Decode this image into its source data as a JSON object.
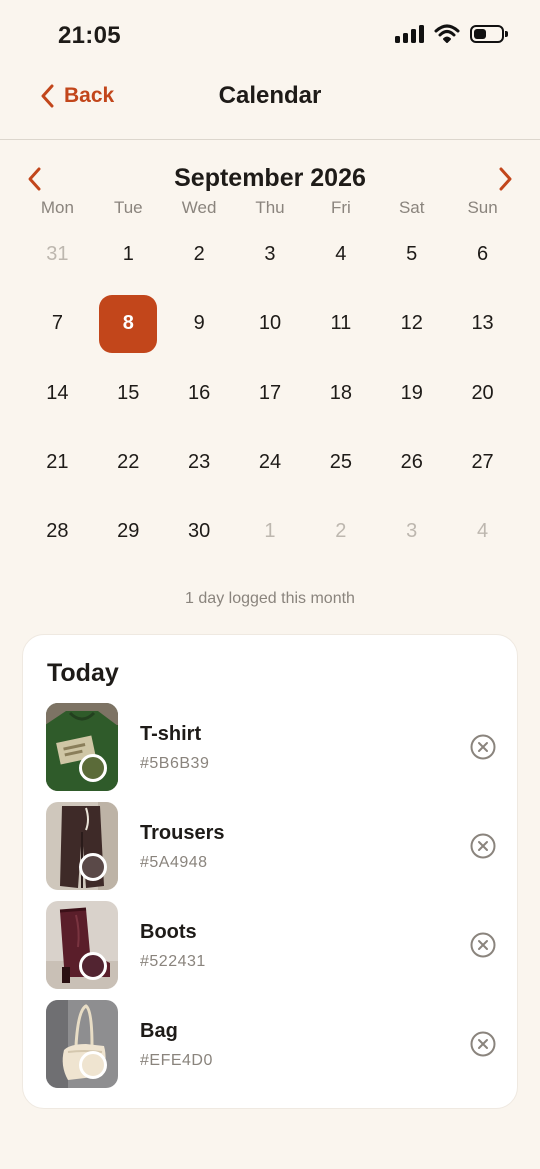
{
  "status_bar": {
    "time": "21:05"
  },
  "nav": {
    "back_label": "Back",
    "title": "Calendar"
  },
  "calendar": {
    "month_title": "September 2026",
    "weekdays": [
      "Mon",
      "Tue",
      "Wed",
      "Thu",
      "Fri",
      "Sat",
      "Sun"
    ],
    "days": [
      {
        "label": "31",
        "muted": true
      },
      {
        "label": "1"
      },
      {
        "label": "2"
      },
      {
        "label": "3"
      },
      {
        "label": "4"
      },
      {
        "label": "5"
      },
      {
        "label": "6"
      },
      {
        "label": "7"
      },
      {
        "label": "8",
        "selected": true
      },
      {
        "label": "9"
      },
      {
        "label": "10"
      },
      {
        "label": "11"
      },
      {
        "label": "12"
      },
      {
        "label": "13"
      },
      {
        "label": "14"
      },
      {
        "label": "15"
      },
      {
        "label": "16"
      },
      {
        "label": "17"
      },
      {
        "label": "18"
      },
      {
        "label": "19"
      },
      {
        "label": "20"
      },
      {
        "label": "21"
      },
      {
        "label": "22"
      },
      {
        "label": "23"
      },
      {
        "label": "24"
      },
      {
        "label": "25"
      },
      {
        "label": "26"
      },
      {
        "label": "27"
      },
      {
        "label": "28"
      },
      {
        "label": "29"
      },
      {
        "label": "30"
      },
      {
        "label": "1",
        "muted": true
      },
      {
        "label": "2",
        "muted": true
      },
      {
        "label": "3",
        "muted": true
      },
      {
        "label": "4",
        "muted": true
      }
    ],
    "summary": "1 day logged this month"
  },
  "today": {
    "title": "Today",
    "items": [
      {
        "name": "T-shirt",
        "hex": "#5B6B39"
      },
      {
        "name": "Trousers",
        "hex": "#5A4948"
      },
      {
        "name": "Boots",
        "hex": "#522431"
      },
      {
        "name": "Bag",
        "hex": "#EFE4D0"
      }
    ]
  },
  "colors": {
    "accent": "#C2461B",
    "background": "#FAF5EE"
  },
  "icons": [
    "chevron-left-icon",
    "chevron-right-icon",
    "remove-circle-icon",
    "signal-icon",
    "wifi-icon",
    "battery-icon"
  ]
}
